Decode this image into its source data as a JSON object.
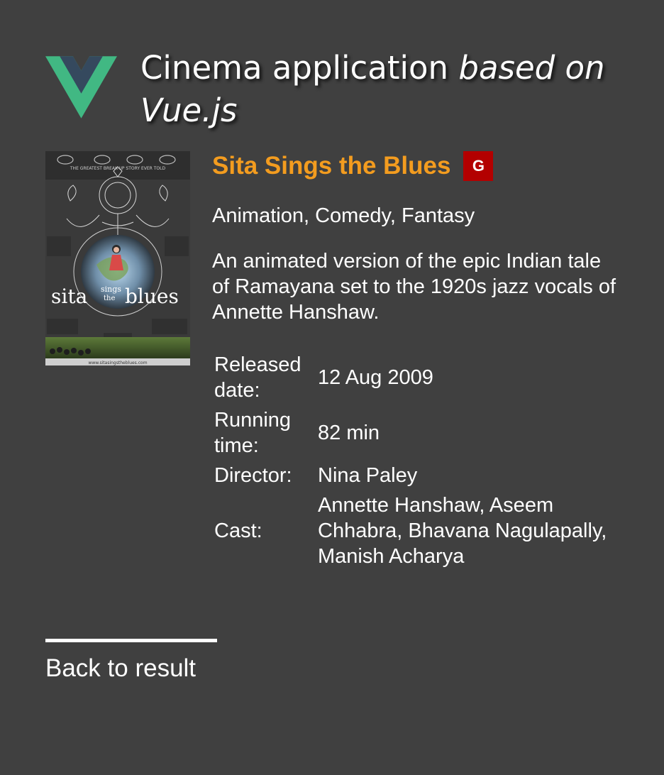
{
  "header": {
    "title_main": "Cinema application ",
    "title_emphasis": "based on Vue.js",
    "logo_icon": "vue-logo-icon",
    "logo_colors": {
      "outer": "#41b883",
      "inner": "#35495e"
    }
  },
  "movie": {
    "title": "Sita Sings the Blues",
    "rating": "G",
    "rating_color": "#b30000",
    "title_color": "#f39c1f",
    "genres": "Animation, Comedy, Fantasy",
    "description": "An animated version of the epic Indian tale of Ramayana set to the 1920s jazz vocals of Annette Hanshaw.",
    "info": [
      {
        "label": "Released date:",
        "value": "12 Aug 2009"
      },
      {
        "label": "Running time:",
        "value": "82 min"
      },
      {
        "label": "Director:",
        "value": "Nina Paley"
      },
      {
        "label": "Cast:",
        "value": "Annette Hanshaw, Aseem Chhabra, Bhavana Nagulapally, Manish Acharya"
      }
    ],
    "poster": {
      "tagline": "THE GREATEST BREAK-UP STORY EVER TOLD",
      "title_line1": "sita",
      "title_sings": "sings",
      "title_the": "the",
      "title_blues": "blues",
      "url": "www.sitasingstheblues.com"
    }
  },
  "navigation": {
    "back_label": "Back to result"
  }
}
